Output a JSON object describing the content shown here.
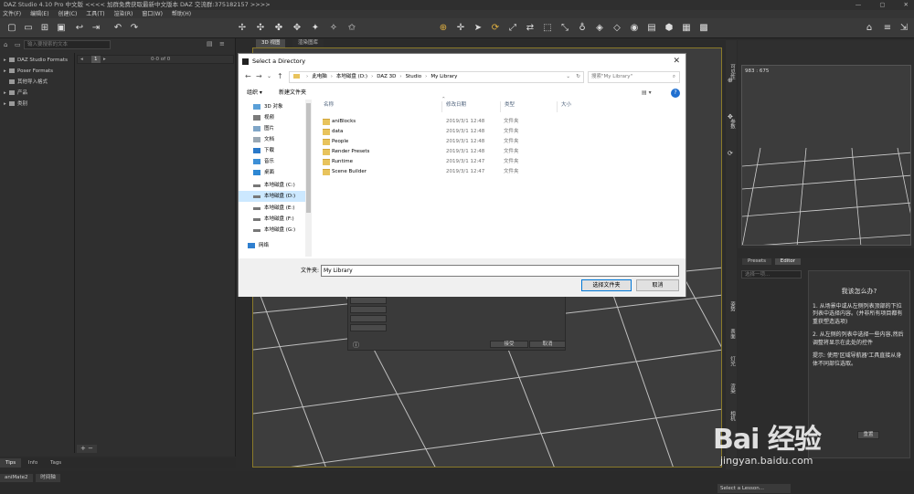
{
  "titlebar": {
    "title": "DAZ Studio 4.10 Pro 中文版   <<<<   加群免费获取最新中文版本 DAZ 交流群:375182157   >>>>",
    "min": "—",
    "max": "▢",
    "close": "✕"
  },
  "menubar": {
    "items": [
      "文件(F)",
      "编辑(E)",
      "创建(C)",
      "工具(T)",
      "渲染(R)",
      "窗口(W)",
      "帮助(H)"
    ]
  },
  "left_panel": {
    "search_placeholder": "输入要搜索的文本",
    "tree": [
      {
        "label": "DAZ Studio Formats"
      },
      {
        "label": "Poser Formats"
      },
      {
        "label": "其他导入格式"
      },
      {
        "label": "产品"
      },
      {
        "label": "类别"
      }
    ],
    "count": "1",
    "range": "0-0 of 0",
    "bottom_tabs": [
      "Tips",
      "Info",
      "Tags"
    ]
  },
  "viewport": {
    "tabs": [
      "3D 视图",
      "渲染图库"
    ]
  },
  "aux_viewport": {
    "readout": "983 : 675"
  },
  "right_panel": {
    "tabs": [
      "Presets",
      "Editor"
    ],
    "wizard_select": "选择一项...",
    "howto_title": "我该怎么办?",
    "steps": [
      "1. 从场景中或从左侧列表顶部的下拉列表中选择内容。(并非所有项目都有重获塑造选项)",
      "2. 从左侧的列表中选择一些内容,然后调整将显示在此处的控件",
      "提示: 使用'区域导航器'工具直接从身体不同部位选取。"
    ],
    "strip_labels": [
      "可见性",
      "参数",
      "姿势",
      "表面",
      "灯光",
      "渲染",
      "相机"
    ],
    "bottom_btn": "重置"
  },
  "statusbar": {
    "tabs": [
      "aniMate2",
      "时间轴"
    ],
    "lesson": "Select a Lesson..."
  },
  "bg_dialog": {
    "ok": "接受",
    "cancel": "取消"
  },
  "dialog": {
    "title": "Select a Directory",
    "close": "✕",
    "address": [
      "此电脑",
      "本地磁盘 (D:)",
      "DAZ 3D",
      "Studio",
      "My Library"
    ],
    "search_placeholder": "搜索\"My Library\"",
    "organize": "组织 ▾",
    "new_folder": "新建文件夹",
    "nav_items": [
      {
        "label": "3D 对象",
        "selected": false
      },
      {
        "label": "视频",
        "selected": false
      },
      {
        "label": "图片",
        "selected": false
      },
      {
        "label": "文档",
        "selected": false
      },
      {
        "label": "下载",
        "selected": false
      },
      {
        "label": "音乐",
        "selected": false
      },
      {
        "label": "桌面",
        "selected": false
      },
      {
        "label": "本地磁盘 (C:)",
        "selected": false
      },
      {
        "label": "本地磁盘 (D:)",
        "selected": true
      },
      {
        "label": "本地磁盘 (E:)",
        "selected": false
      },
      {
        "label": "本地磁盘 (F:)",
        "selected": false
      },
      {
        "label": "本地磁盘 (G:)",
        "selected": false
      },
      {
        "label": "网络",
        "selected": false
      }
    ],
    "columns": [
      "名称",
      "修改日期",
      "类型",
      "大小"
    ],
    "files": [
      {
        "name": "aniBlocks",
        "date": "2019/3/1 12:48",
        "type": "文件夹"
      },
      {
        "name": "data",
        "date": "2019/3/1 12:48",
        "type": "文件夹"
      },
      {
        "name": "People",
        "date": "2019/3/1 12:48",
        "type": "文件夹"
      },
      {
        "name": "Render Presets",
        "date": "2019/3/1 12:48",
        "type": "文件夹"
      },
      {
        "name": "Runtime",
        "date": "2019/3/1 12:47",
        "type": "文件夹"
      },
      {
        "name": "Scene Builder",
        "date": "2019/3/1 12:47",
        "type": "文件夹"
      }
    ],
    "folder_label": "文件夹:",
    "folder_value": "My Library",
    "select_button": "选择文件夹",
    "cancel_button": "取消"
  },
  "watermark": {
    "text": "Bai 经验",
    "url": "jingyan.baidu.com"
  }
}
